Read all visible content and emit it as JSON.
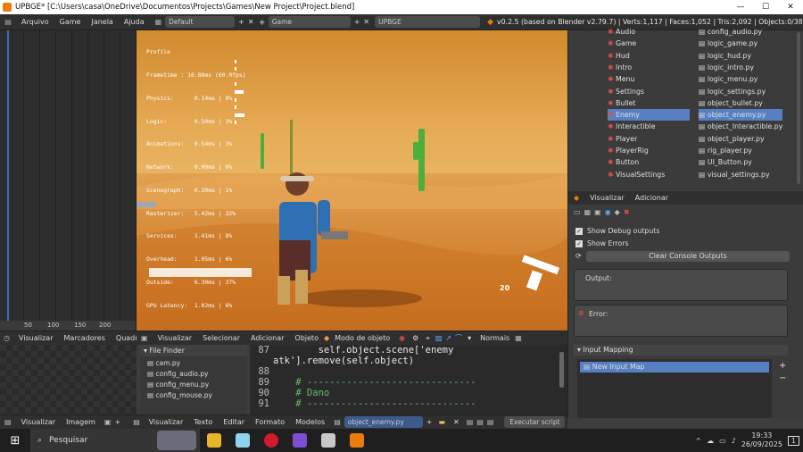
{
  "titlebar": {
    "title": "UPBGE* [C:\\Users\\casa\\OneDrive\\Documentos\\Projects\\Games\\New Project\\Project.blend]"
  },
  "infobar": {
    "menus": [
      "Arquivo",
      "Game",
      "Janela",
      "Ajuda"
    ],
    "layout": "Default",
    "scene": "Game",
    "engine": "UPBGE",
    "stats": "v0.2.5 (based on Blender v2.79.7) | Verts:1,117 | Faces:1,052 | Tris:2,092 | Objects:0/38"
  },
  "timeline": {
    "ticks": [
      "50",
      "100",
      "150",
      "200"
    ]
  },
  "profile": {
    "title": "Profile",
    "lines": [
      "Frametime : 16.88ms (60.0fps)",
      "Physics:      0.14ms | 0%",
      "Logic:        0.50ms | 3%",
      "Animations:   0.54ms | 3%",
      "Network:      0.00ms | 0%",
      "Scenegraph:   0.20ms | 1%",
      "Rasterizer:   5.42ms | 32%",
      "Services:     1.41ms | 8%",
      "Overhead:     1.05ms | 6%",
      "Outside:      6.30ms | 37%",
      "GPU Latency:  1.02ms | 6%"
    ],
    "percents": [
      0,
      3,
      3,
      0,
      1,
      32,
      8,
      6,
      37,
      6
    ],
    "ammo": "20"
  },
  "outliner": {
    "left": [
      "Audio",
      "Game",
      "Hud",
      "Intro",
      "Menu",
      "Settings",
      "Bullet",
      "Enemy",
      "Interactible",
      "Player",
      "PlayerRig",
      "Button",
      "VisualSettings"
    ],
    "right": [
      "config_audio.py",
      "logic_game.py",
      "logic_hud.py",
      "logic_intro.py",
      "logic_menu.py",
      "logic_settings.py",
      "object_bullet.py",
      "object_enemy.py",
      "object_Interactible.py",
      "object_player.py",
      "rig_player.py",
      "UI_Button.py",
      "visual_settings.py"
    ],
    "selected_index": 7
  },
  "props": {
    "tabs": [
      "Visualizar",
      "Adicionar"
    ],
    "show_debug": "Show Debug outputs",
    "show_errors": "Show Errors",
    "clear": "Clear Console Outputs",
    "output": "Output:",
    "error": "Error:",
    "input_mapping": "Input Mapping",
    "new_map": "New Input Map"
  },
  "viewport_hdr": [
    "Visualizar",
    "Selecionar",
    "Adicionar",
    "Objeto",
    "Modo de objeto",
    "Normais"
  ],
  "bottom_left_hdr": [
    "Visualizar",
    "Marcadores",
    "Quadro"
  ],
  "file_finder": {
    "title": "File Finder",
    "files": [
      "cam.py",
      "config_audio.py",
      "config_menu.py",
      "config_mouse.py"
    ]
  },
  "code": {
    "lines": [
      {
        "n": "87",
        "t": "        self.object.scene['enemy"
      },
      {
        "n": "",
        "t": "atk'].remove(self.object)"
      },
      {
        "n": "88",
        "t": ""
      },
      {
        "n": "89",
        "t": "    # ------------------------------"
      },
      {
        "n": "90",
        "t": "    # Dano"
      },
      {
        "n": "91",
        "t": "    # ------------------------------"
      }
    ]
  },
  "bottom_hdr": [
    "Visualizar",
    "Imagem",
    "Visualizar",
    "Texto",
    "Editar",
    "Formato",
    "Modelos"
  ],
  "text_file": "object_enemy.py",
  "run_script": "Executar script",
  "taskbar": {
    "search": "Pesquisar",
    "time": "19:33",
    "date": "26/09/2025",
    "notif": "1"
  }
}
